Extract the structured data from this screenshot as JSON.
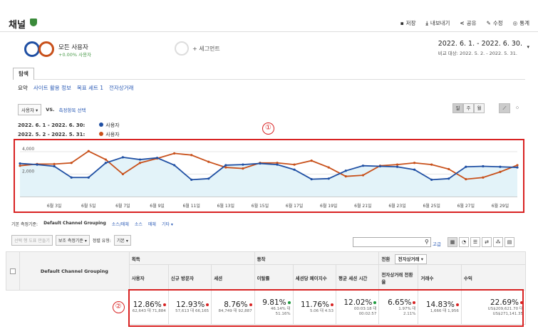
{
  "header": {
    "title": "채널",
    "actions": {
      "save": "저장",
      "export": "내보내기",
      "share": "공유",
      "edit": "수정",
      "insights": "통계"
    }
  },
  "segments": {
    "all_users": {
      "name": "모든 사용자",
      "sub": "+0.00% 사용자"
    },
    "add": "+ 세그먼트"
  },
  "date_range": {
    "primary": "2022. 6. 1. - 2022. 6. 30.",
    "compare_label": "비교 대상:",
    "compare": "2022. 5. 2. - 2022. 5. 31."
  },
  "tabs": {
    "explore": "탐색"
  },
  "subtabs": [
    "요약",
    "사이트 활용 정보",
    "목표 세트 1",
    "전자상거래"
  ],
  "controls": {
    "metric": "사용자",
    "vs": "VS.",
    "select_metric": "측정항목 선택"
  },
  "view_buttons": {
    "day": "일",
    "week": "주",
    "month": "월"
  },
  "legend": [
    {
      "range": "2022. 6. 1 - 2022. 6. 30:",
      "label": "사용자",
      "color": "#1f4fa3"
    },
    {
      "range": "2022. 5. 2 - 2022. 5. 31:",
      "label": "사용자",
      "color": "#c8501a"
    }
  ],
  "annotations": {
    "one": "①",
    "two": "②"
  },
  "chart_data": {
    "type": "line",
    "y_ticks": [
      "4,000",
      "2,000"
    ],
    "x_ticks": [
      "6월 3일",
      "6월 5일",
      "6월 7일",
      "6월 9일",
      "6월 11일",
      "6월 13일",
      "6월 15일",
      "6월 17일",
      "6월 19일",
      "6월 21일",
      "6월 23일",
      "6월 25일",
      "6월 27일",
      "6월 29일"
    ],
    "ylim": [
      0,
      4700
    ],
    "series": [
      {
        "name": "사용자",
        "period": "2022. 6. 1 - 2022. 6. 30",
        "color": "#1f4fa3",
        "values": [
          2950,
          2850,
          2700,
          1700,
          1700,
          3000,
          3500,
          3300,
          3450,
          2800,
          1500,
          1600,
          2800,
          2850,
          2950,
          2850,
          2400,
          1550,
          1600,
          2300,
          2750,
          2700,
          2650,
          2400,
          1500,
          1600,
          2650,
          2700,
          2650,
          2600
        ]
      },
      {
        "name": "사용자",
        "period": "2022. 5. 2 - 2022. 5. 31",
        "color": "#c8501a",
        "values": [
          2750,
          2900,
          2900,
          3000,
          4050,
          3300,
          2000,
          3000,
          3400,
          3850,
          3700,
          3100,
          2600,
          2500,
          3000,
          3000,
          2850,
          3200,
          2600,
          1800,
          1900,
          2750,
          2850,
          3000,
          2850,
          2450,
          1550,
          1700,
          2200,
          2800
        ]
      }
    ]
  },
  "table_controls": {
    "primary_dim_label": "기본 측정기준:",
    "primary_dim": "Default Channel Grouping",
    "source_medium": "소스/매체",
    "source": "소스",
    "medium": "매체",
    "other": "기타",
    "plot_rows": "선택 행 도표 만들기",
    "secondary_dim": "보조 측정기준",
    "sort_type_label": "정렬 유형:",
    "sort_type": "기본",
    "advanced": "고급",
    "conversion_label": "전환",
    "conversion_value": "전자상거래"
  },
  "table": {
    "dim_header": "Default Channel Grouping",
    "groups": {
      "acquisition": "획득",
      "behavior": "동작",
      "conversion": "전환"
    },
    "columns": [
      "사용자",
      "신규 방문자",
      "세션",
      "이탈률",
      "세션당 페이지수",
      "평균 세션 시간",
      "전자상거래 전환율",
      "거래수",
      "수익"
    ],
    "totals": [
      {
        "pct": "12.86%",
        "dot": "red",
        "detail": [
          "62,643 대 71,884"
        ]
      },
      {
        "pct": "12.93%",
        "dot": "red",
        "detail": [
          "57,613 대 66,165"
        ]
      },
      {
        "pct": "8.76%",
        "dot": "red",
        "detail": [
          "84,749 대 92,887"
        ]
      },
      {
        "pct": "9.81%",
        "dot": "green",
        "detail": [
          "46.14% 대",
          "51.16%"
        ]
      },
      {
        "pct": "11.76%",
        "dot": "red",
        "detail": [
          "5.06 대 4.53"
        ]
      },
      {
        "pct": "12.02%",
        "dot": "green",
        "detail": [
          "00:03:18 대",
          "00:02:57"
        ]
      },
      {
        "pct": "6.65%",
        "dot": "red",
        "detail": [
          "1.97% 대",
          "2.11%"
        ]
      },
      {
        "pct": "14.83%",
        "dot": "red",
        "detail": [
          "1,666 대 1,956"
        ]
      },
      {
        "pct": "22.69%",
        "dot": "red",
        "detail": [
          "US$209,621.70 대",
          "US$271,141.35"
        ]
      }
    ]
  }
}
